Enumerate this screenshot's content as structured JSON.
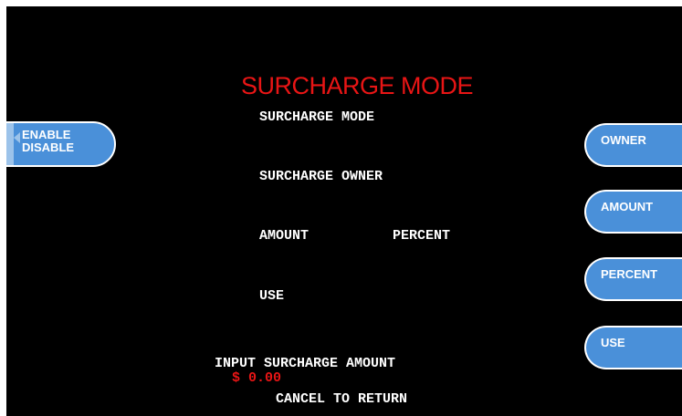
{
  "screen": {
    "title": "SURCHARGE MODE",
    "lines": {
      "mode": "SURCHARGE MODE",
      "owner": "SURCHARGE OWNER",
      "amount": "AMOUNT",
      "percent": "PERCENT",
      "use": "USE"
    },
    "prompt": "INPUT SURCHARGE AMOUNT",
    "value": "$ 0.00",
    "cancel": "CANCEL TO RETURN"
  },
  "buttons": {
    "left": {
      "line1": "ENABLE",
      "line2": "DISABLE"
    },
    "right": [
      "OWNER",
      "AMOUNT",
      "PERCENT",
      "USE"
    ]
  },
  "colors": {
    "background": "#000000",
    "title": "#e81515",
    "button": "#4a90d9"
  }
}
